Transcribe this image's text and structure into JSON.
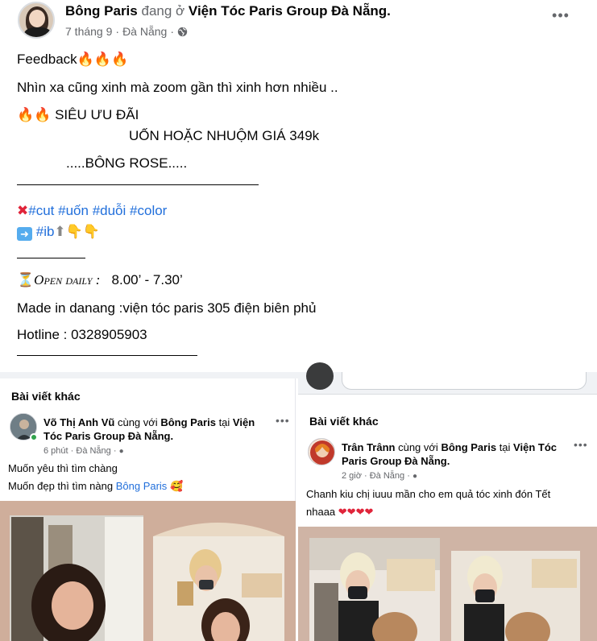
{
  "post": {
    "author": "Bông Paris",
    "checkin_word": "đang ở",
    "location": "Viện Tóc Paris Group Đà Nẵng.",
    "date": "7 tháng 9",
    "place": "Đà Nẵng",
    "dot": "·",
    "more_icon": "more-horizontal-icon",
    "privacy_icon": "globe-icon",
    "lines": {
      "feedback": "Feedback",
      "tagline": "Nhìn xa cũng xinh mà zoom gần thì xinh hơn nhiều ..",
      "promo": "SIÊU ƯU ĐÃI",
      "offer": "UỐN HOẶC NHUỘM GIÁ 349k",
      "brand": ".....BÔNG ROSE.....",
      "hashtags": [
        "#cut",
        "#uốn",
        "#duỗi",
        "#color"
      ],
      "ib": "#ib",
      "open_label": "Open daily :",
      "open_hours": "8.00’ - 7.30’",
      "made_in": "Made in danang :viện tóc paris 305 điện biên phủ",
      "hotline": "Hotline : 0328905903"
    }
  },
  "left_card": {
    "section_title": "Bài viết khác",
    "author": "Võ Thị Anh Vũ",
    "with_word": "cùng với",
    "tagged": "Bông Paris",
    "at_word": "tại",
    "location": "Viện Tóc Paris Group Đà Nẵng.",
    "time": "6 phút",
    "place": "Đà Nẵng",
    "line1": "Muốn yêu thì tìm chàng",
    "line2_prefix": "Muốn đẹp thì tìm nàng",
    "line2_link": "Bông Paris"
  },
  "right_card": {
    "section_title": "Bài viết khác",
    "author": "Trân Trânn",
    "with_word": "cùng với",
    "tagged": "Bông Paris",
    "at_word": "tại",
    "location": "Viện Tóc Paris Group Đà Nẵng.",
    "time": "2 giờ",
    "place": "Đà Nẵng",
    "line1": "Chanh kiu chị iuuu mần cho em quả tóc xinh đón Tết",
    "line2": "nhaaa"
  },
  "colors": {
    "link": "#216fdb",
    "muted": "#65676b",
    "online": "#31a24c",
    "heart": "#e0243a"
  }
}
